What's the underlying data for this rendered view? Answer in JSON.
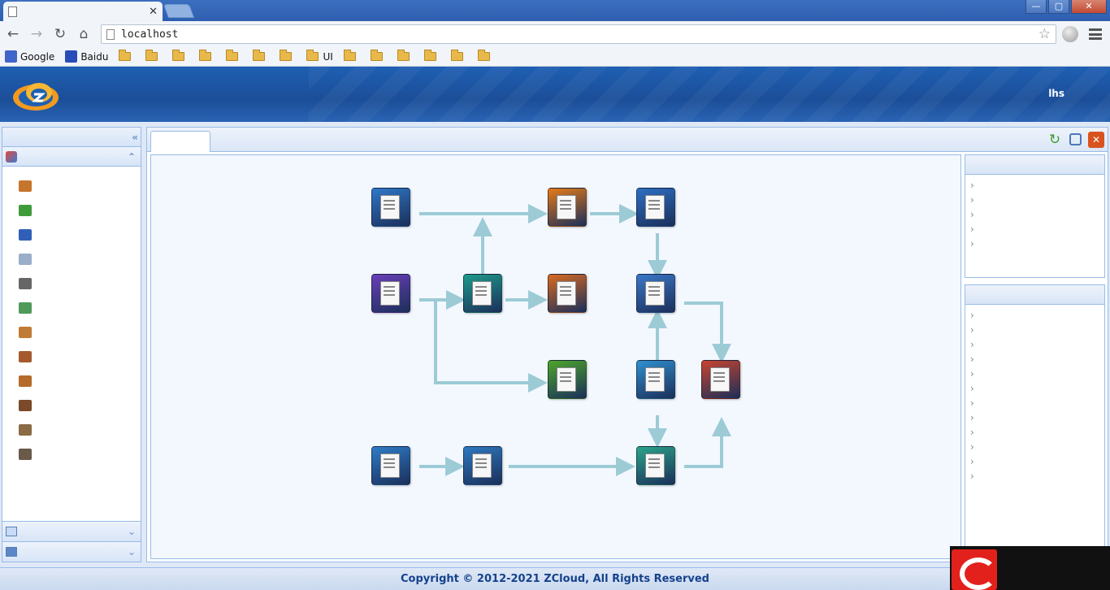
{
  "browser": {
    "tab_title": "",
    "tab_close": "✕",
    "window_buttons": {
      "minimize": "—",
      "maximize": "▢",
      "close": "✕"
    },
    "url": "localhost",
    "nav": {
      "back": "←",
      "forward": "→",
      "reload": "↻",
      "home": "⌂"
    },
    "bookmarks": [
      {
        "label": "Google",
        "icon": "google-icon"
      },
      {
        "label": "Baidu",
        "icon": "baidu-icon"
      },
      {
        "label": "",
        "icon": "folder-icon"
      },
      {
        "label": "",
        "icon": "folder-icon"
      },
      {
        "label": "",
        "icon": "folder-icon"
      },
      {
        "label": "",
        "icon": "folder-icon"
      },
      {
        "label": "",
        "icon": "folder-icon"
      },
      {
        "label": "",
        "icon": "folder-icon"
      },
      {
        "label": "",
        "icon": "folder-icon"
      },
      {
        "label": "UI",
        "icon": "folder-icon"
      },
      {
        "label": "",
        "icon": "folder-icon"
      },
      {
        "label": "",
        "icon": "folder-icon"
      },
      {
        "label": "",
        "icon": "folder-icon"
      },
      {
        "label": "",
        "icon": "folder-icon"
      },
      {
        "label": "",
        "icon": "folder-icon"
      },
      {
        "label": "",
        "icon": "folder-icon"
      }
    ]
  },
  "header": {
    "title": "",
    "welcome": "",
    "user": "lhs",
    "change_password": "",
    "logout": ""
  },
  "leftnav": {
    "title": "",
    "collapse": "«",
    "section": {
      "title": "",
      "toggle": "⌃"
    },
    "items": [
      {
        "label": "",
        "color": "#c8752c"
      },
      {
        "label": "",
        "color": "#3f9a3a"
      },
      {
        "label": "",
        "color": "#2f5fb8"
      },
      {
        "label": "",
        "color": "#9aaec9"
      },
      {
        "label": "",
        "color": "#666666"
      },
      {
        "label": "",
        "color": "#4f9a5a"
      },
      {
        "label": "",
        "color": "#c07b34"
      },
      {
        "label": "",
        "color": "#a55a2e"
      },
      {
        "label": "",
        "color": "#b56b2a"
      },
      {
        "label": "",
        "color": "#7b4a2a"
      },
      {
        "label": "",
        "color": "#8a6b45"
      },
      {
        "label": "",
        "color": "#6a5a4a"
      }
    ],
    "bottom": [
      {
        "title": "",
        "toggle": "⌄"
      },
      {
        "title": "",
        "toggle": "⌄"
      }
    ]
  },
  "center": {
    "tab": "",
    "tools": {
      "refresh": "↻",
      "close": "✕"
    },
    "nodes": [
      {
        "label": "",
        "color": "#2f78c8"
      },
      {
        "label": "",
        "color": "#e57a17"
      },
      {
        "label": "",
        "color": "#2d6fc4"
      },
      {
        "label": "",
        "color": "#6a3fb8"
      },
      {
        "label": "",
        "color": "#1e9a8a"
      },
      {
        "label": "",
        "color": "#d86a21"
      },
      {
        "label": "",
        "color": "#3a78c9"
      },
      {
        "label": "",
        "color": "#4da52a"
      },
      {
        "label": "",
        "color": "#2f8fd0"
      },
      {
        "label": "",
        "color": "#c7442f"
      },
      {
        "label": "",
        "color": "#2f7cc7"
      },
      {
        "label": "",
        "color": "#2e79c0"
      },
      {
        "label": "",
        "color": "#2aa58a"
      }
    ]
  },
  "reports": {
    "title": "",
    "links": [
      "",
      "",
      "",
      "",
      ""
    ]
  },
  "docs": {
    "title": "",
    "links": [
      "",
      "",
      "",
      "",
      "",
      "",
      "",
      "",
      "",
      "",
      "",
      ""
    ]
  },
  "footer": {
    "copyright": "Copyright © 2012-2021 ZCloud, All Rights Reserved"
  },
  "colors": {
    "brand_blue": "#1f5fb2",
    "panel_border": "#99bbe8",
    "heading_text": "#15428b",
    "arrow": "#9ccbd6"
  }
}
